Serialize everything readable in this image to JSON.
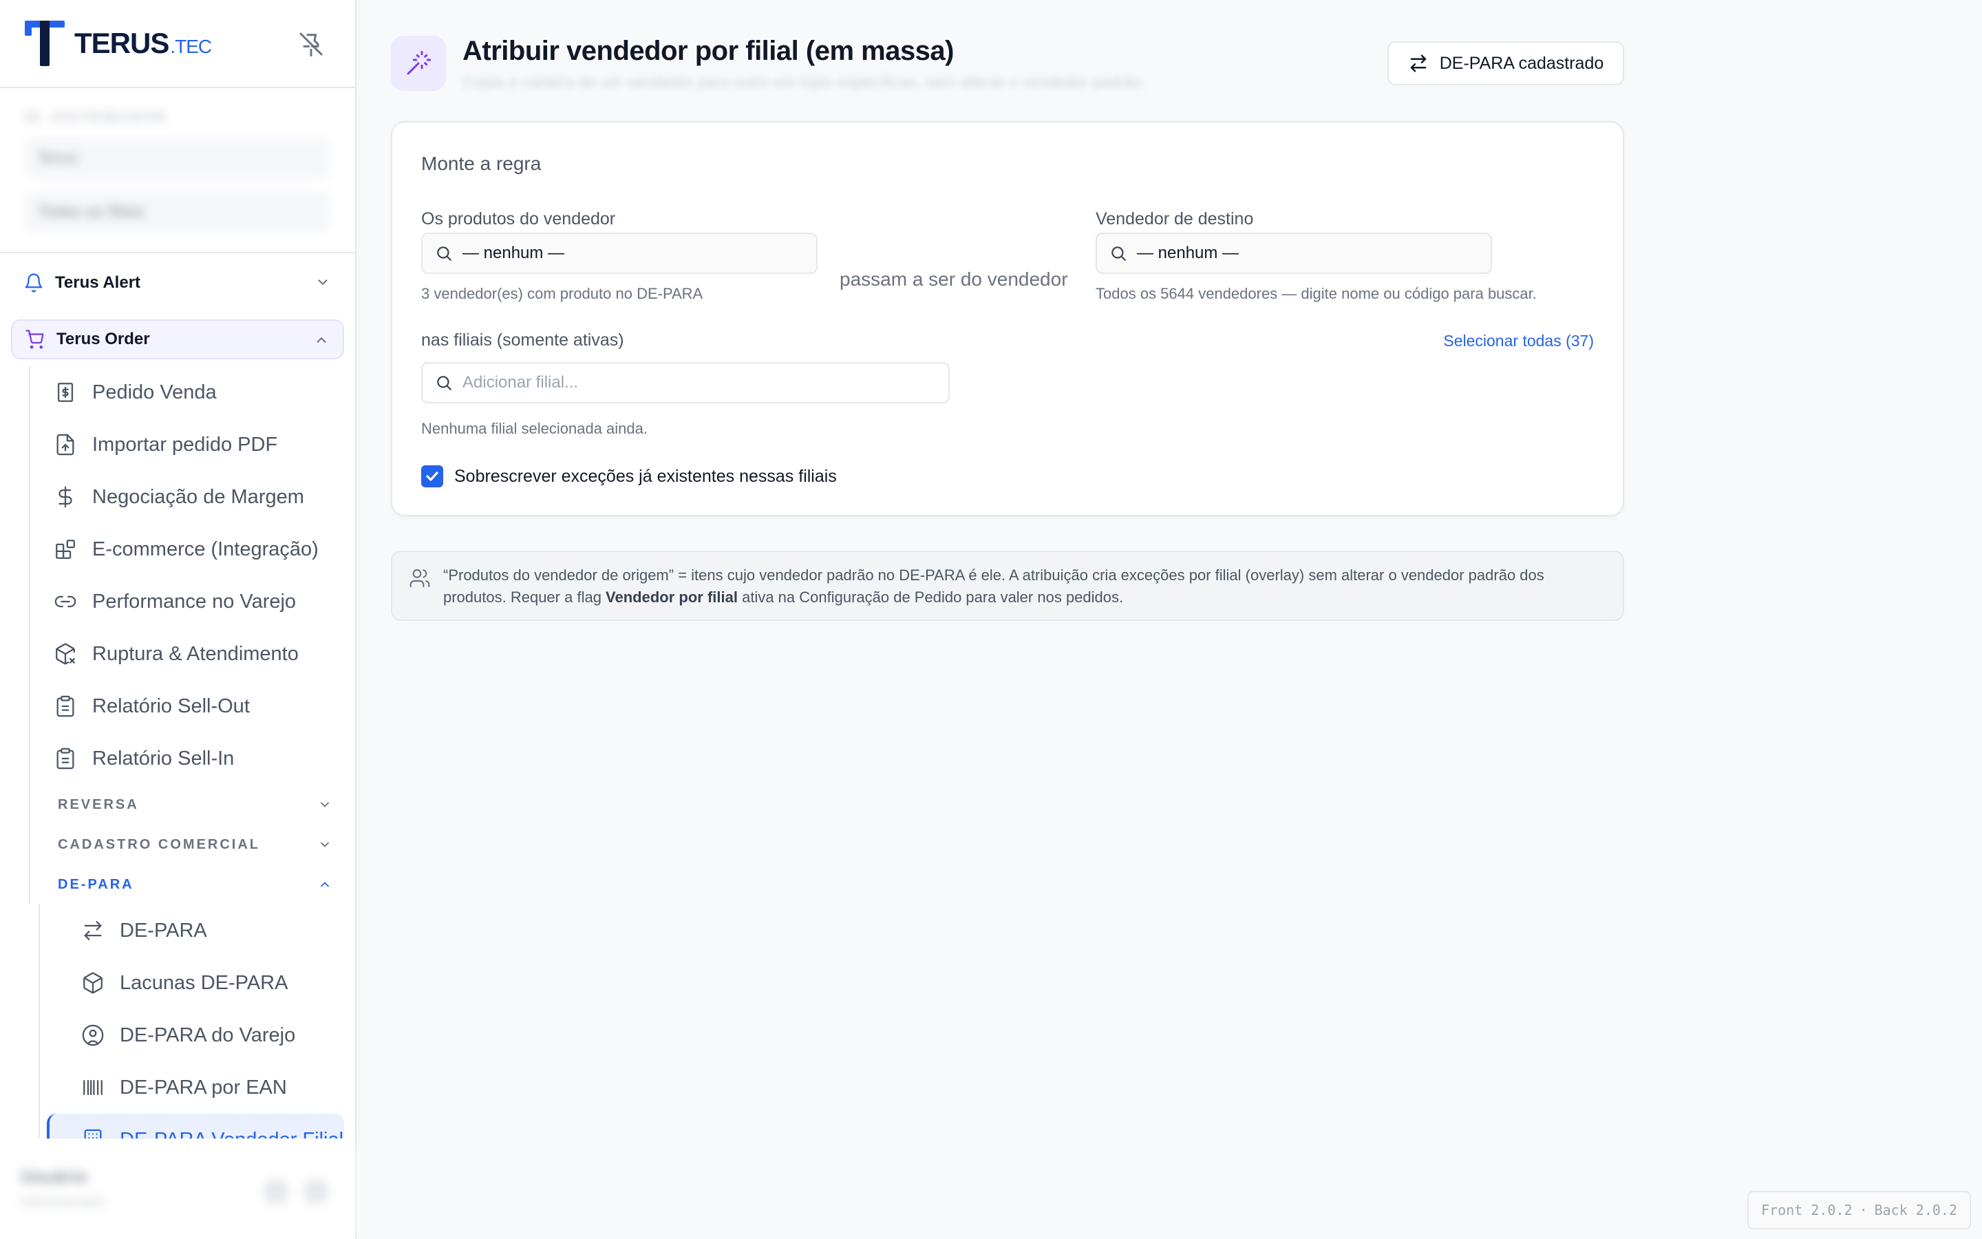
{
  "brand": {
    "name": "TERUS",
    "suffix": ".TEC"
  },
  "context": {
    "label": "ID. DISTRIBUIDOR",
    "select1": "Terus",
    "select2": "Todas as filiais"
  },
  "sidebar": {
    "groups": [
      {
        "label": "Terus Alert"
      },
      {
        "label": "Terus Order"
      }
    ],
    "order_items": [
      {
        "label": "Pedido Venda",
        "icon": "receipt-icon"
      },
      {
        "label": "Importar pedido PDF",
        "icon": "file-upload-icon"
      },
      {
        "label": "Negociação de Margem",
        "icon": "dollar-icon"
      },
      {
        "label": "E-commerce (Integração)",
        "icon": "blocks-icon"
      },
      {
        "label": "Performance no Varejo",
        "icon": "link-icon"
      },
      {
        "label": "Ruptura & Atendimento",
        "icon": "package-x-icon"
      },
      {
        "label": "Relatório Sell-Out",
        "icon": "clipboard-icon"
      },
      {
        "label": "Relatório Sell-In",
        "icon": "clipboard-icon"
      }
    ],
    "sections": [
      {
        "label": "REVERSA"
      },
      {
        "label": "CADASTRO COMERCIAL"
      },
      {
        "label": "DE-PARA"
      }
    ],
    "depara_items": [
      {
        "label": "DE-PARA",
        "icon": "arrows-swap-icon"
      },
      {
        "label": "Lacunas DE-PARA",
        "icon": "box-icon"
      },
      {
        "label": "DE-PARA do Varejo",
        "icon": "user-circle-icon"
      },
      {
        "label": "DE-PARA por EAN",
        "icon": "barcode-icon"
      },
      {
        "label": "DE-PARA Vendedor Filial",
        "icon": "building-icon"
      }
    ],
    "user": {
      "name": "Usuário",
      "role": "Administrador"
    }
  },
  "header": {
    "title": "Atribuir vendedor por filial (em massa)",
    "subtitle": "Copia a carteira de um vendedor para outro em lojas específicas, sem alterar o vendedor padrão.",
    "button_label": "DE-PARA cadastrado"
  },
  "rule": {
    "title": "Monte a regra",
    "source_label": "Os produtos do vendedor",
    "source_value": "— nenhum —",
    "source_helper": "3 vendedor(es) com produto no DE-PARA",
    "middle_text": "passam a ser do vendedor",
    "target_label": "Vendedor de destino",
    "target_value": "— nenhum —",
    "target_helper": "Todos os 5644 vendedores — digite nome ou código para buscar.",
    "branches_label": "nas filiais (somente ativas)",
    "select_all": "Selecionar todas (37)",
    "branch_placeholder": "Adicionar filial...",
    "branch_helper": "Nenhuma filial selecionada ainda.",
    "overwrite_label": "Sobrescrever exceções já existentes nessas filiais",
    "overwrite_checked": true
  },
  "info": {
    "text_a": "“Produtos do vendedor de origem” = itens cujo vendedor padrão no DE-PARA é ele. A atribuição cria exceções por filial (overlay) sem alterar o vendedor padrão dos produtos. Requer a flag ",
    "text_bold": "Vendedor por filial",
    "text_b": " ativa na Configuração de Pedido para valer nos pedidos."
  },
  "version": {
    "front": "Front 2.0.2",
    "sep": "·",
    "back": "Back 2.0.2"
  },
  "colors": {
    "accent": "#2563eb",
    "purple": "#7c3aed",
    "text": "#111827"
  }
}
